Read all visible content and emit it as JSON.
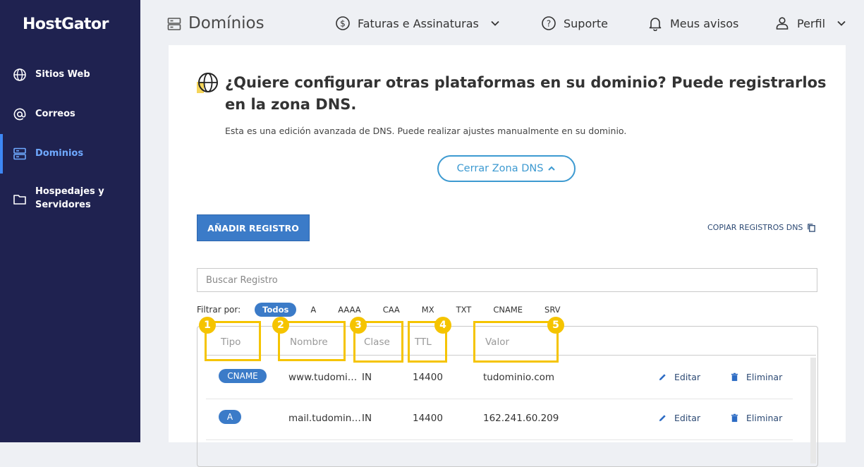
{
  "sidebar": {
    "logo": "HostGator",
    "items": [
      {
        "label": "Sitios Web",
        "icon": "globe-icon"
      },
      {
        "label": "Correos",
        "icon": "at-icon"
      },
      {
        "label": "Dominios",
        "icon": "server-icon",
        "active": true
      },
      {
        "label_line1": "Hospedajes y",
        "label_line2": "Servidores",
        "icon": "folder-icon"
      }
    ]
  },
  "header": {
    "title": "Domínios",
    "billing": "Faturas e Assinaturas",
    "support": "Suporte",
    "notices": "Meus avisos",
    "profile": "Perfil"
  },
  "promo": {
    "title": "¿Quiere configurar otras plataformas en su dominio? Puede registrarlos en la zona DNS.",
    "subtitle": "Esta es una edición avanzada de DNS. Puede realizar ajustes manualmente en su dominio.",
    "close_button": "Cerrar Zona DNS"
  },
  "toolbar": {
    "add_button": "AÑADIR REGISTRO",
    "copy_link": "COPIAR REGISTROS DNS"
  },
  "search": {
    "placeholder": "Buscar Registro"
  },
  "filter": {
    "label": "Filtrar por:",
    "options": [
      "Todos",
      "A",
      "AAAA",
      "CAA",
      "MX",
      "TXT",
      "CNAME",
      "SRV"
    ],
    "active": "Todos"
  },
  "table": {
    "headers": [
      "Tipo",
      "Nombre",
      "Clase",
      "TTL",
      "Valor"
    ],
    "rows": [
      {
        "type": "CNAME",
        "name": "www.tudomi…",
        "class": "IN",
        "ttl": "14400",
        "value": "tudominio.com",
        "edit": "Editar",
        "delete": "Eliminar"
      },
      {
        "type": "A",
        "name": "mail.tudomin…",
        "class": "IN",
        "ttl": "14400",
        "value": "162.241.60.209",
        "edit": "Editar",
        "delete": "Eliminar"
      }
    ]
  },
  "annotations": [
    "1",
    "2",
    "3",
    "4",
    "5"
  ],
  "colors": {
    "sidebar": "#1f2250",
    "primary": "#3b7bc8",
    "accent_link": "#3d9ad1",
    "annotation": "#f5c400"
  }
}
